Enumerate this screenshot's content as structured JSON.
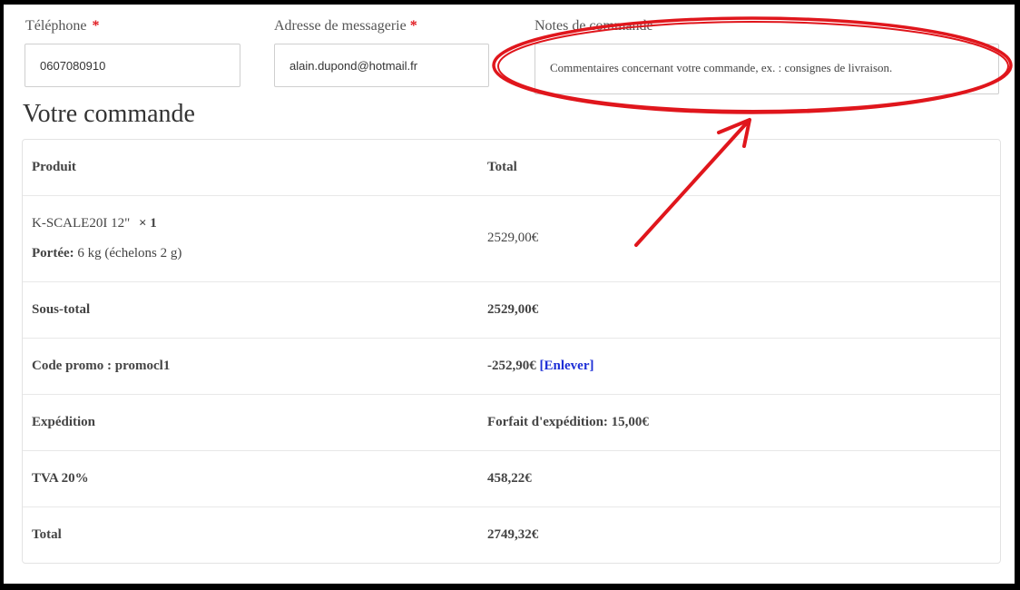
{
  "form": {
    "phone_label": "Téléphone",
    "phone_required_mark": "*",
    "phone_value": "0607080910",
    "email_label": "Adresse de messagerie",
    "email_required_mark": "*",
    "email_value": "alain.dupond@hotmail.fr",
    "notes_label": "Notes de commande",
    "notes_placeholder": "Commentaires concernant votre commande, ex. : consignes de livraison."
  },
  "order": {
    "title": "Votre commande",
    "header": {
      "product": "Produit",
      "total": "Total"
    },
    "item": {
      "name": "K-SCALE20I 12\"",
      "quantity": "× 1",
      "meta_label": "Portée:",
      "meta_value": "6 kg (échelons 2 g)",
      "total": "2529,00€"
    },
    "subtotal": {
      "label": "Sous-total",
      "value": "2529,00€"
    },
    "coupon": {
      "label": "Code promo : promocl1",
      "value": "-252,90€",
      "remove_label": "[Enlever]"
    },
    "shipping": {
      "label": "Expédition",
      "value": "Forfait d'expédition: 15,00€"
    },
    "tax": {
      "label": "TVA 20%",
      "value": "458,22€"
    },
    "grand_total": {
      "label": "Total",
      "value": "2749,32€"
    }
  },
  "colors": {
    "annotation_red": "#e0161c",
    "link_blue": "#1d2fd6",
    "border_black": "#000000"
  }
}
